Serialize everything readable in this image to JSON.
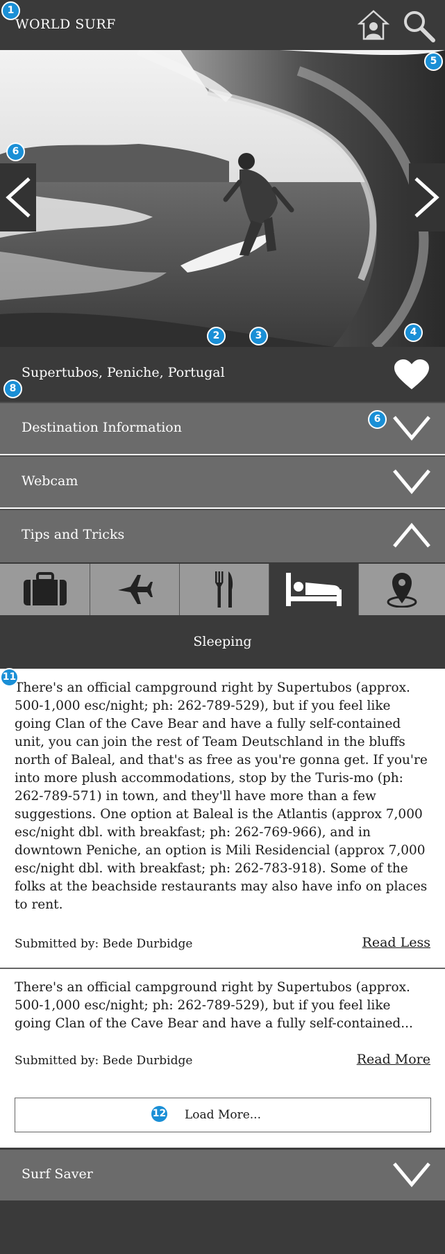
{
  "app": {
    "title": "WORLD SURF"
  },
  "header": {
    "home_icon": "home-icon",
    "search_icon": "search-icon"
  },
  "hero": {
    "image_desc": "surfer-in-barrel-photo",
    "prev_icon": "chevron-left-icon",
    "next_icon": "chevron-right-icon"
  },
  "location": {
    "name": "Supertubos, Peniche, Portugal",
    "favorite_icon": "heart-icon"
  },
  "accordion": {
    "destination": "Destination Information",
    "webcam": "Webcam",
    "tips": "Tips and Tricks",
    "surf_saver": "Surf Saver"
  },
  "categories": [
    {
      "icon": "suitcase-icon",
      "active": false
    },
    {
      "icon": "airplane-icon",
      "active": false
    },
    {
      "icon": "fork-knife-icon",
      "active": false
    },
    {
      "icon": "bed-icon",
      "active": true
    },
    {
      "icon": "map-pin-icon",
      "active": false
    }
  ],
  "section": {
    "title": "Sleeping"
  },
  "tips": [
    {
      "text": "There's an official campground right by Supertubos (approx. 500-1,000 esc/night; ph: 262-789-529), but if you feel like going Clan of the Cave Bear and have a fully self-contained unit, you can join the rest of Team Deutschland in the bluffs north of Baleal, and that's as free as you're gonna get. If you're into more plush accommodations, stop by the Turis-mo (ph: 262-789-571) in town, and they'll have more than a few suggestions. One option at Baleal is the Atlantis (approx 7,000 esc/night dbl. with breakfast; ph: 262-769-966), and in downtown Peniche, an option is Mili Residencial (approx 7,000 esc/night dbl. with breakfast; ph: 262-783-918). Some of the folks at the beachside restaurants may also have info on places to rent.",
      "submitted_by": "Submitted by:  Bede Durbidge",
      "link": "Read Less"
    },
    {
      "text": "There's an official campground right by Supertubos (approx. 500-1,000 esc/night; ph: 262-789-529), but if you feel like going Clan of the Cave Bear and have a fully self-contained...",
      "submitted_by": "Submitted by:  Bede Durbidge",
      "link": "Read More"
    }
  ],
  "load_more": "Load More...",
  "annotations": [
    "1",
    "2",
    "3",
    "4",
    "5",
    "6",
    "6",
    "8",
    "11",
    "12"
  ],
  "colors": {
    "badge": "#1a8fd6",
    "dark": "#3a3a3a",
    "accordion": "#6b6b6b",
    "category": "#9a9a9a"
  }
}
